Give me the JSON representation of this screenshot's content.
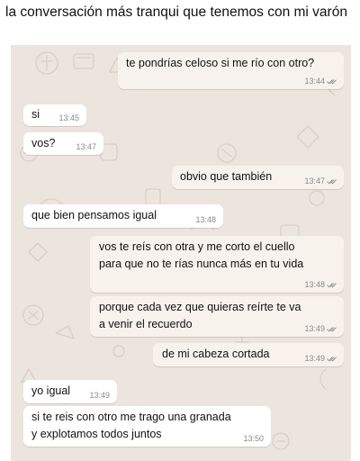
{
  "post": {
    "caption": "la conversación más tranqui que tenemos con mi varón"
  },
  "messages": [
    {
      "text": "te pondrías celoso si me río con otro?",
      "time": "13:44",
      "direction": "outgoing",
      "status": "read"
    },
    {
      "text": "si",
      "time": "13:45",
      "direction": "incoming"
    },
    {
      "text": "vos?",
      "time": "13:47",
      "direction": "incoming"
    },
    {
      "text": "obvio que también",
      "time": "13:47",
      "direction": "outgoing",
      "status": "read"
    },
    {
      "text": "que bien pensamos igual",
      "time": "13:48",
      "direction": "incoming"
    },
    {
      "lines": [
        "vos te reís con otra y me corto el cuello",
        "para que no te rías nunca más en tu vida"
      ],
      "time": "13:48",
      "direction": "outgoing",
      "status": "read"
    },
    {
      "lines": [
        "porque cada vez que quieras reírte te va",
        "a venir el recuerdo"
      ],
      "time": "13:49",
      "direction": "outgoing",
      "status": "read"
    },
    {
      "text": "de mi cabeza cortada",
      "time": "13:49",
      "direction": "outgoing",
      "status": "read"
    },
    {
      "text": "yo igual",
      "time": "13:49",
      "direction": "incoming"
    },
    {
      "lines": [
        "si te reis con otro me trago una granada",
        "y explotamos todos juntos"
      ],
      "time": "13:50",
      "direction": "incoming"
    }
  ],
  "colors": {
    "chat_background": "#ece5dd",
    "incoming_bubble": "#ffffff",
    "outgoing_bubble": "#f7f3ec",
    "read_checks": "#8a8a8a"
  },
  "icons": {
    "read_status": "double-check-icon",
    "background": "doodle-pattern"
  }
}
